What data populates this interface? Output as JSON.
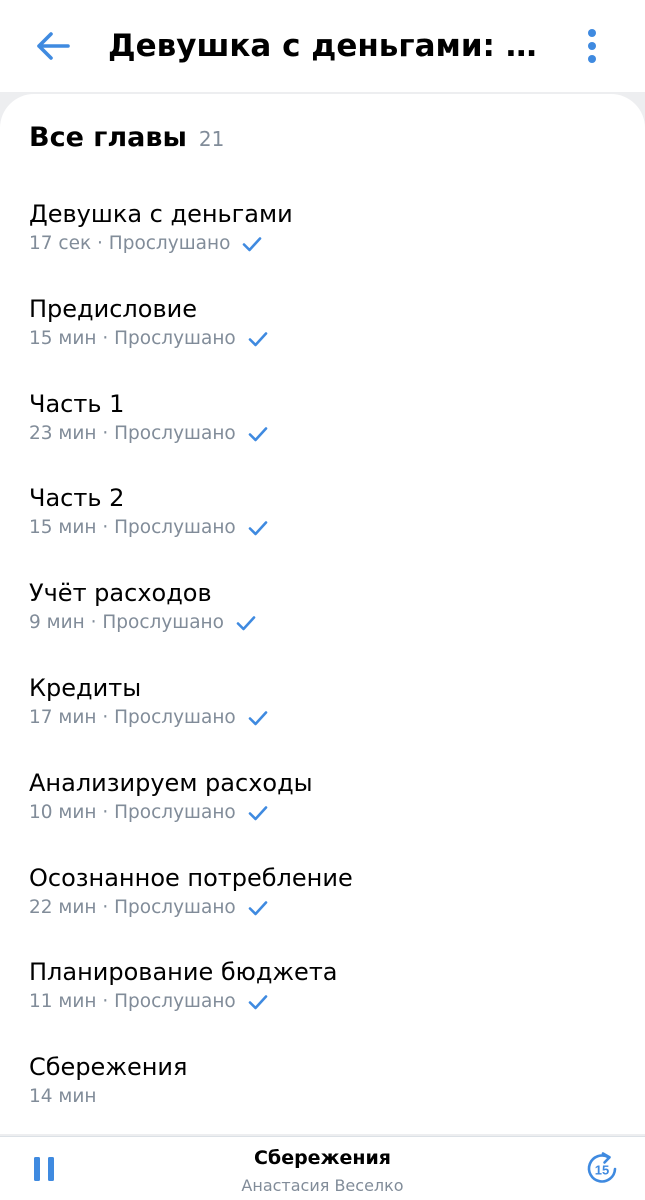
{
  "header": {
    "title": "Девушка с деньгами: Кн...",
    "back_icon": "arrow-left-icon",
    "menu_icon": "more-vertical-icon"
  },
  "section": {
    "title": "Все главы",
    "count": "21"
  },
  "chapters": [
    {
      "title": "Девушка с деньгами",
      "meta": "17 сек · Прослушано",
      "listened": true
    },
    {
      "title": "Предисловие",
      "meta": "15 мин · Прослушано",
      "listened": true
    },
    {
      "title": "Часть 1",
      "meta": "23 мин · Прослушано",
      "listened": true
    },
    {
      "title": "Часть 2",
      "meta": "15 мин · Прослушано",
      "listened": true
    },
    {
      "title": "Учёт расходов",
      "meta": "9 мин · Прослушано",
      "listened": true
    },
    {
      "title": "Кредиты",
      "meta": "17 мин · Прослушано",
      "listened": true
    },
    {
      "title": "Анализируем расходы",
      "meta": "10 мин · Прослушано",
      "listened": true
    },
    {
      "title": "Осознанное потребление",
      "meta": "22 мин · Прослушано",
      "listened": true
    },
    {
      "title": "Планирование бюджета",
      "meta": "11 мин · Прослушано",
      "listened": true
    },
    {
      "title": "Сбережения",
      "meta": "14 мин",
      "listened": false
    }
  ],
  "player": {
    "title": "Сбережения",
    "author": "Анастасия Веселко",
    "skip_label": "15",
    "pause_icon": "pause-icon",
    "skip_icon": "skip-forward-15-icon"
  },
  "colors": {
    "accent": "#3f8ae0",
    "secondary_text": "#818c99"
  }
}
